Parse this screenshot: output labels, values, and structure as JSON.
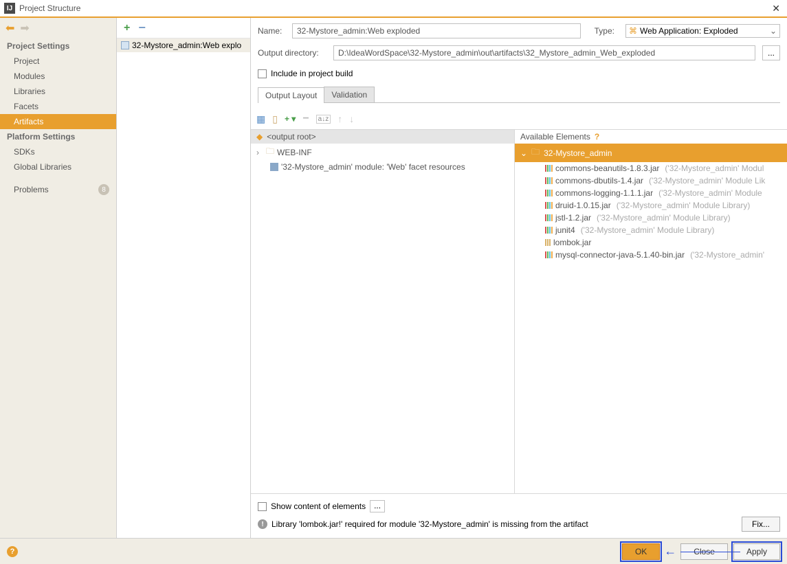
{
  "window": {
    "title": "Project Structure",
    "close": "✕"
  },
  "sidebar": {
    "projectSettings": "Project Settings",
    "items1": [
      "Project",
      "Modules",
      "Libraries",
      "Facets",
      "Artifacts"
    ],
    "platformSettings": "Platform Settings",
    "items2": [
      "SDKs",
      "Global Libraries"
    ],
    "problems": "Problems",
    "problemsCount": "8"
  },
  "artifactList": {
    "name": "32-Mystore_admin:Web explo"
  },
  "form": {
    "nameLabel": "Name:",
    "nameValue": "32-Mystore_admin:Web exploded",
    "typeLabel": "Type:",
    "typeValue": "Web Application: Exploded",
    "outDirLabel": "Output directory:",
    "outDirValue": "D:\\IdeaWordSpace\\32-Mystore_admin\\out\\artifacts\\32_Mystore_admin_Web_exploded",
    "browse": "...",
    "include": "Include in project build"
  },
  "tabs": {
    "output": "Output Layout",
    "validation": "Validation"
  },
  "tree": {
    "root": "<output root>",
    "webinf": "WEB-INF",
    "facet": "'32-Mystore_admin' module: 'Web' facet resources"
  },
  "avail": {
    "header": "Available Elements",
    "project": "32-Mystore_admin",
    "libs": [
      {
        "name": "commons-beanutils-1.8.3.jar",
        "hint": "('32-Mystore_admin' Modul"
      },
      {
        "name": "commons-dbutils-1.4.jar",
        "hint": "('32-Mystore_admin' Module Lik"
      },
      {
        "name": "commons-logging-1.1.1.jar",
        "hint": "('32-Mystore_admin' Module"
      },
      {
        "name": "druid-1.0.15.jar",
        "hint": "('32-Mystore_admin' Module Library)"
      },
      {
        "name": "jstl-1.2.jar",
        "hint": "('32-Mystore_admin' Module Library)"
      },
      {
        "name": "junit4",
        "hint": "('32-Mystore_admin' Module Library)"
      },
      {
        "name": "lombok.jar",
        "hint": "",
        "single": true
      },
      {
        "name": "mysql-connector-java-5.1.40-bin.jar",
        "hint": "('32-Mystore_admin'"
      }
    ]
  },
  "bottom": {
    "showContent": "Show content of elements",
    "ellipsis": "...",
    "warning": "Library 'lombok.jar!' required for module '32-Mystore_admin' is missing from the artifact",
    "fix": "Fix..."
  },
  "footer": {
    "ok": "OK",
    "close": "Close",
    "apply": "Apply"
  }
}
